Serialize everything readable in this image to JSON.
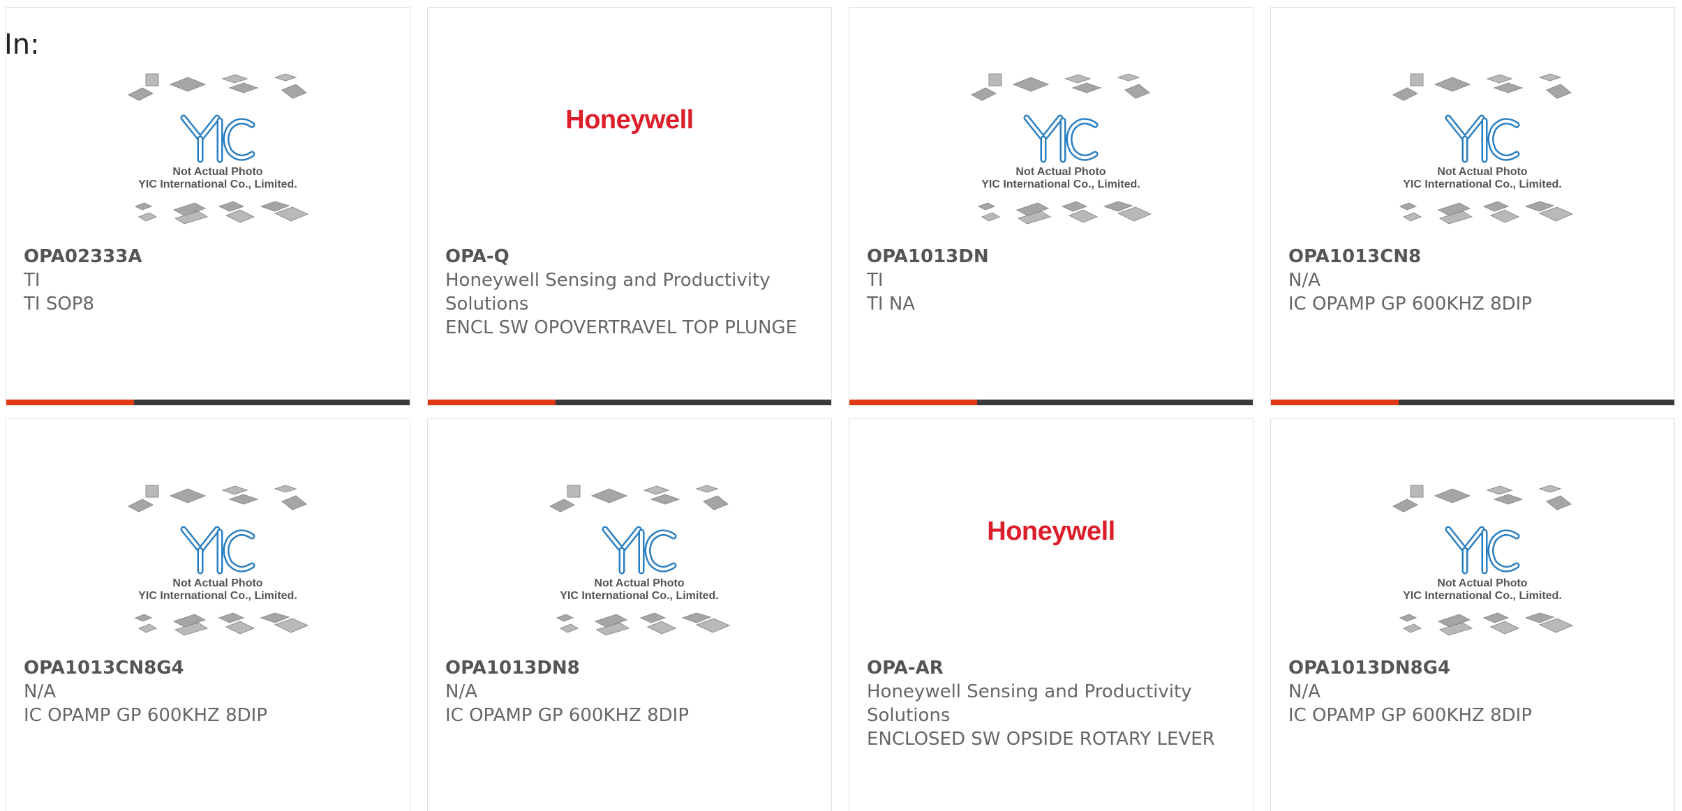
{
  "page": {
    "heading": "In:"
  },
  "placeholder": {
    "caption_line1": "Not Actual Photo",
    "caption_line2": "YIC International Co., Limited.",
    "logo_text": "YIC"
  },
  "colors": {
    "accent": "#e03a15",
    "bar": "#3a3a3a",
    "honeywell_red": "#dc1e2a",
    "yic_blue": "#2a7fc1"
  },
  "products": [
    {
      "part": "OPA02333A",
      "brand": "TI",
      "desc": "TI SOP8",
      "image": "yic-placeholder"
    },
    {
      "part": "OPA-Q",
      "brand": "Honeywell Sensing and Productivity Solutions",
      "desc": "ENCL SW OPOVERTRAVEL TOP PLUNGE",
      "image": "honeywell-logo",
      "logo_text": "Honeywell"
    },
    {
      "part": "OPA1013DN",
      "brand": "TI",
      "desc": "TI NA",
      "image": "yic-placeholder"
    },
    {
      "part": "OPA1013CN8",
      "brand": "N/A",
      "desc": "IC OPAMP GP 600KHZ 8DIP",
      "image": "yic-placeholder"
    },
    {
      "part": "OPA1013CN8G4",
      "brand": "N/A",
      "desc": "IC OPAMP GP 600KHZ 8DIP",
      "image": "yic-placeholder"
    },
    {
      "part": "OPA1013DN8",
      "brand": "N/A",
      "desc": "IC OPAMP GP 600KHZ 8DIP",
      "image": "yic-placeholder"
    },
    {
      "part": "OPA-AR",
      "brand": "Honeywell Sensing and Productivity Solutions",
      "desc": "ENCLOSED SW OPSIDE ROTARY LEVER",
      "image": "honeywell-logo",
      "logo_text": "Honeywell"
    },
    {
      "part": "OPA1013DN8G4",
      "brand": "N/A",
      "desc": "IC OPAMP GP 600KHZ 8DIP",
      "image": "yic-placeholder"
    }
  ]
}
